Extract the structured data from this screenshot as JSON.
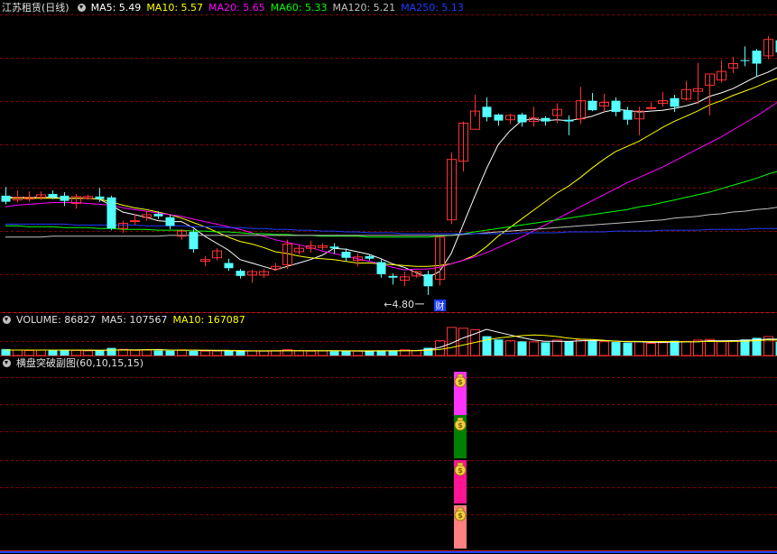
{
  "main_panel": {
    "stock_name": "江苏租赁",
    "period": "(日线)",
    "ma": [
      {
        "label": "MA5: 5.49",
        "color": "#ffffff"
      },
      {
        "label": "MA10: 5.57",
        "color": "#ffff00"
      },
      {
        "label": "MA20: 5.65",
        "color": "#ff00ff"
      },
      {
        "label": "MA60: 5.33",
        "color": "#00ff00"
      },
      {
        "label": "MA120: 5.21",
        "color": "#c0c0c0"
      },
      {
        "label": "MA250: 5.13",
        "color": "#1e3cff"
      }
    ],
    "low_marker": "4.80",
    "finance_marker": "财"
  },
  "volume_panel": {
    "title": "VOLUME: 86827",
    "ma5": "MA5: 107567",
    "ma10": "MA10: 167087"
  },
  "indicator_panel": {
    "title": "横盘突破副图(60,10,15,15)",
    "signal_icon": "money-bag-icon",
    "segment_colors": [
      "#ff33ff",
      "#008000",
      "#ff1493",
      "#ff8080"
    ]
  },
  "colors": {
    "up": "#ff3232",
    "down": "#54ffff",
    "grid": "#8b0000",
    "frame": "#b22222"
  },
  "chart_data": [
    {
      "type": "candlestick",
      "title": "江苏租赁 (日线)",
      "low_annotation": 4.8,
      "ohlc": [
        [
          5.95,
          5.88,
          6.05,
          5.85
        ],
        [
          5.9,
          5.93,
          6.01,
          5.87
        ],
        [
          5.91,
          5.93,
          6.0,
          5.88
        ],
        [
          5.93,
          5.96,
          6.0,
          5.9
        ],
        [
          5.97,
          5.93,
          6.01,
          5.91
        ],
        [
          5.95,
          5.89,
          5.99,
          5.83
        ],
        [
          5.86,
          5.94,
          5.97,
          5.8
        ],
        [
          5.92,
          5.94,
          5.96,
          5.9
        ],
        [
          5.94,
          5.91,
          6.04,
          5.88
        ],
        [
          5.93,
          5.57,
          5.95,
          5.55
        ],
        [
          5.57,
          5.63,
          5.66,
          5.52
        ],
        [
          5.65,
          5.66,
          5.74,
          5.61
        ],
        [
          5.7,
          5.73,
          5.77,
          5.66
        ],
        [
          5.74,
          5.71,
          5.77,
          5.68
        ],
        [
          5.7,
          5.6,
          5.73,
          5.56
        ],
        [
          5.48,
          5.54,
          5.56,
          5.44
        ],
        [
          5.53,
          5.33,
          5.56,
          5.29
        ],
        [
          5.19,
          5.21,
          5.25,
          5.13
        ],
        [
          5.23,
          5.31,
          5.34,
          5.2
        ],
        [
          5.17,
          5.11,
          5.22,
          5.08
        ],
        [
          5.08,
          5.02,
          5.1,
          4.99
        ],
        [
          5.03,
          5.07,
          5.09,
          4.94
        ],
        [
          5.03,
          5.07,
          5.1,
          5.0
        ],
        [
          5.1,
          5.13,
          5.17,
          5.08
        ],
        [
          5.15,
          5.39,
          5.44,
          5.1
        ],
        [
          5.3,
          5.34,
          5.38,
          5.27
        ],
        [
          5.34,
          5.37,
          5.43,
          5.29
        ],
        [
          5.35,
          5.37,
          5.4,
          5.32
        ],
        [
          5.36,
          5.34,
          5.4,
          5.28
        ],
        [
          5.3,
          5.23,
          5.34,
          5.19
        ],
        [
          5.2,
          5.24,
          5.28,
          5.13
        ],
        [
          5.25,
          5.22,
          5.27,
          5.2
        ],
        [
          5.18,
          5.04,
          5.21,
          5.0
        ],
        [
          5.02,
          5.0,
          5.05,
          4.92
        ],
        [
          4.97,
          5.01,
          5.07,
          4.9
        ],
        [
          5.02,
          5.07,
          5.08,
          5.0
        ],
        [
          5.04,
          4.9,
          5.08,
          4.8
        ],
        [
          4.98,
          5.47,
          5.48,
          4.91
        ],
        [
          5.67,
          6.37,
          6.45,
          5.62
        ],
        [
          6.35,
          6.79,
          6.81,
          6.23
        ],
        [
          6.72,
          6.93,
          7.12,
          6.87
        ],
        [
          6.98,
          6.86,
          7.09,
          6.81
        ],
        [
          6.89,
          6.82,
          6.9,
          6.76
        ],
        [
          6.83,
          6.88,
          6.9,
          6.78
        ],
        [
          6.89,
          6.8,
          6.91,
          6.75
        ],
        [
          6.81,
          6.85,
          6.98,
          6.75
        ],
        [
          6.85,
          6.81,
          6.87,
          6.76
        ],
        [
          6.88,
          6.95,
          7.02,
          6.79
        ],
        [
          6.83,
          6.81,
          6.88,
          6.65
        ],
        [
          6.84,
          7.05,
          7.21,
          6.78
        ],
        [
          7.05,
          6.94,
          7.14,
          6.93
        ],
        [
          6.99,
          7.03,
          7.13,
          6.92
        ],
        [
          7.05,
          6.92,
          7.09,
          6.87
        ],
        [
          6.94,
          6.83,
          6.98,
          6.77
        ],
        [
          6.84,
          6.93,
          6.98,
          6.65
        ],
        [
          6.96,
          6.97,
          7.03,
          6.95
        ],
        [
          7.02,
          7.05,
          7.15,
          6.98
        ],
        [
          7.08,
          6.98,
          7.12,
          6.92
        ],
        [
          7.07,
          7.18,
          7.28,
          7.05
        ],
        [
          7.16,
          7.19,
          7.49,
          7.01
        ],
        [
          7.23,
          7.36,
          7.35,
          6.88
        ],
        [
          7.29,
          7.39,
          7.52,
          7.26
        ],
        [
          7.43,
          7.48,
          7.56,
          7.37
        ],
        [
          7.52,
          7.51,
          7.68,
          7.45
        ],
        [
          7.63,
          7.48,
          7.65,
          7.33
        ],
        [
          7.57,
          7.76,
          7.8,
          7.53
        ],
        [
          7.75,
          7.61,
          7.92,
          7.58
        ]
      ],
      "ma_series": [
        {
          "name": "MA5",
          "values": [
            5.93,
            5.93,
            5.93,
            5.93,
            5.93,
            5.92,
            5.92,
            5.92,
            5.91,
            5.84,
            5.76,
            5.73,
            5.7,
            5.66,
            5.65,
            5.65,
            5.58,
            5.48,
            5.4,
            5.32,
            5.21,
            5.17,
            5.13,
            5.09,
            5.13,
            5.17,
            5.21,
            5.26,
            5.34,
            5.33,
            5.3,
            5.27,
            5.22,
            5.16,
            5.12,
            5.06,
            5.0,
            5.07,
            5.28,
            5.61,
            5.94,
            6.26,
            6.54,
            6.7,
            6.82,
            6.84,
            6.82,
            6.83,
            6.82,
            6.84,
            6.87,
            6.92,
            6.95,
            6.94,
            6.92,
            6.93,
            6.94,
            6.96,
            6.99,
            7.03,
            7.1,
            7.14,
            7.19,
            7.26,
            7.33,
            7.38,
            7.45
          ]
        },
        {
          "name": "MA10",
          "values": [
            5.92,
            5.92,
            5.92,
            5.92,
            5.92,
            5.92,
            5.92,
            5.92,
            5.91,
            5.88,
            5.84,
            5.81,
            5.79,
            5.76,
            5.73,
            5.69,
            5.64,
            5.59,
            5.53,
            5.47,
            5.42,
            5.39,
            5.35,
            5.3,
            5.28,
            5.25,
            5.23,
            5.22,
            5.21,
            5.19,
            5.17,
            5.17,
            5.16,
            5.15,
            5.14,
            5.13,
            5.13,
            5.14,
            5.16,
            5.2,
            5.26,
            5.36,
            5.48,
            5.58,
            5.68,
            5.78,
            5.88,
            5.98,
            6.06,
            6.16,
            6.27,
            6.37,
            6.46,
            6.52,
            6.58,
            6.66,
            6.74,
            6.81,
            6.87,
            6.93,
            7.0,
            7.05,
            7.11,
            7.16,
            7.21,
            7.27,
            7.32
          ]
        },
        {
          "name": "MA20",
          "values": [
            5.82,
            5.84,
            5.85,
            5.86,
            5.87,
            5.87,
            5.87,
            5.86,
            5.85,
            5.84,
            5.81,
            5.79,
            5.77,
            5.75,
            5.73,
            5.71,
            5.68,
            5.65,
            5.62,
            5.59,
            5.56,
            5.52,
            5.48,
            5.44,
            5.41,
            5.38,
            5.35,
            5.31,
            5.28,
            5.25,
            5.22,
            5.19,
            5.16,
            5.12,
            5.09,
            5.1,
            5.1,
            5.12,
            5.16,
            5.2,
            5.24,
            5.29,
            5.35,
            5.41,
            5.47,
            5.54,
            5.61,
            5.68,
            5.75,
            5.82,
            5.89,
            5.96,
            6.03,
            6.1,
            6.16,
            6.22,
            6.28,
            6.35,
            6.42,
            6.49,
            6.56,
            6.63,
            6.71,
            6.79,
            6.87,
            6.96,
            7.05
          ]
        },
        {
          "name": "MA60",
          "values": [
            5.6,
            5.6,
            5.59,
            5.59,
            5.59,
            5.58,
            5.58,
            5.58,
            5.57,
            5.57,
            5.56,
            5.56,
            5.56,
            5.55,
            5.55,
            5.55,
            5.54,
            5.54,
            5.53,
            5.53,
            5.52,
            5.51,
            5.51,
            5.5,
            5.5,
            5.49,
            5.49,
            5.48,
            5.48,
            5.48,
            5.48,
            5.47,
            5.47,
            5.47,
            5.47,
            5.47,
            5.47,
            5.48,
            5.49,
            5.51,
            5.53,
            5.55,
            5.57,
            5.59,
            5.61,
            5.63,
            5.65,
            5.67,
            5.69,
            5.71,
            5.73,
            5.75,
            5.77,
            5.79,
            5.82,
            5.84,
            5.87,
            5.9,
            5.93,
            5.96,
            5.99,
            6.03,
            6.07,
            6.11,
            6.15,
            6.2,
            6.24
          ]
        },
        {
          "name": "MA120",
          "values": [
            5.47,
            5.47,
            5.47,
            5.47,
            5.48,
            5.48,
            5.48,
            5.48,
            5.48,
            5.48,
            5.48,
            5.48,
            5.48,
            5.48,
            5.49,
            5.49,
            5.49,
            5.49,
            5.49,
            5.49,
            5.49,
            5.49,
            5.49,
            5.49,
            5.49,
            5.49,
            5.49,
            5.49,
            5.49,
            5.49,
            5.49,
            5.49,
            5.49,
            5.49,
            5.49,
            5.49,
            5.49,
            5.49,
            5.49,
            5.5,
            5.51,
            5.52,
            5.53,
            5.54,
            5.55,
            5.56,
            5.57,
            5.58,
            5.59,
            5.6,
            5.61,
            5.62,
            5.63,
            5.64,
            5.65,
            5.66,
            5.67,
            5.69,
            5.7,
            5.71,
            5.73,
            5.74,
            5.76,
            5.77,
            5.79,
            5.8,
            5.82
          ]
        },
        {
          "name": "MA250",
          "values": [
            5.62,
            5.62,
            5.62,
            5.62,
            5.62,
            5.62,
            5.61,
            5.61,
            5.61,
            5.61,
            5.61,
            5.61,
            5.6,
            5.6,
            5.6,
            5.6,
            5.59,
            5.59,
            5.59,
            5.58,
            5.58,
            5.57,
            5.57,
            5.56,
            5.56,
            5.55,
            5.55,
            5.54,
            5.54,
            5.53,
            5.53,
            5.52,
            5.52,
            5.52,
            5.51,
            5.51,
            5.51,
            5.51,
            5.51,
            5.51,
            5.51,
            5.51,
            5.51,
            5.51,
            5.52,
            5.52,
            5.52,
            5.52,
            5.53,
            5.53,
            5.53,
            5.53,
            5.54,
            5.54,
            5.54,
            5.54,
            5.55,
            5.55,
            5.55,
            5.55,
            5.56,
            5.56,
            5.56,
            5.56,
            5.57,
            5.57,
            5.57
          ]
        }
      ]
    },
    {
      "type": "bar",
      "title": "VOLUME: 86827",
      "values": [
        40,
        34,
        31,
        33,
        31,
        37,
        32,
        29,
        30,
        47,
        38,
        32,
        34,
        31,
        30,
        35,
        28,
        27,
        28,
        30,
        26,
        29,
        27,
        30,
        37,
        29,
        27,
        28,
        26,
        28,
        27,
        27,
        32,
        30,
        35,
        30,
        48,
        92,
        175,
        170,
        160,
        120,
        100,
        92,
        88,
        85,
        82,
        96,
        90,
        100,
        92,
        86,
        84,
        80,
        86,
        76,
        80,
        92,
        88,
        96,
        100,
        86,
        93,
        100,
        110,
        118,
        86
      ],
      "ma_series": [
        {
          "name": "MA5",
          "values": [
            34,
            34,
            34,
            34,
            34,
            33,
            33,
            32,
            31,
            34,
            35,
            35,
            36,
            37,
            34,
            32,
            32,
            31,
            30,
            30,
            28,
            28,
            28,
            28,
            30,
            30,
            30,
            30,
            29,
            28,
            28,
            27,
            28,
            29,
            30,
            31,
            35,
            50,
            76,
            109,
            135,
            163,
            145,
            128,
            112,
            97,
            89,
            89,
            88,
            91,
            94,
            93,
            90,
            86,
            86,
            82,
            82,
            84,
            85,
            86,
            92,
            91,
            93,
            95,
            98,
            103,
            101
          ]
        },
        {
          "name": "MA10",
          "values": [
            34,
            34,
            34,
            34,
            34,
            34,
            34,
            34,
            33,
            34,
            34,
            34,
            35,
            35,
            34,
            34,
            34,
            33,
            32,
            32,
            31,
            30,
            30,
            30,
            30,
            30,
            30,
            30,
            29,
            29,
            29,
            29,
            29,
            29,
            30,
            30,
            32,
            37,
            49,
            65,
            81,
            97,
            109,
            117,
            124,
            128,
            125,
            118,
            108,
            102,
            100,
            95,
            89,
            88,
            88,
            87,
            87,
            87,
            86,
            86,
            88,
            87,
            88,
            89,
            92,
            97,
            96
          ]
        }
      ]
    },
    {
      "type": "bar",
      "title": "横盘突破副图(60,10,15,15)",
      "signal_index": 37,
      "segments": [
        "#ff33ff",
        "#008000",
        "#ff1493",
        "#ff8080"
      ]
    }
  ]
}
